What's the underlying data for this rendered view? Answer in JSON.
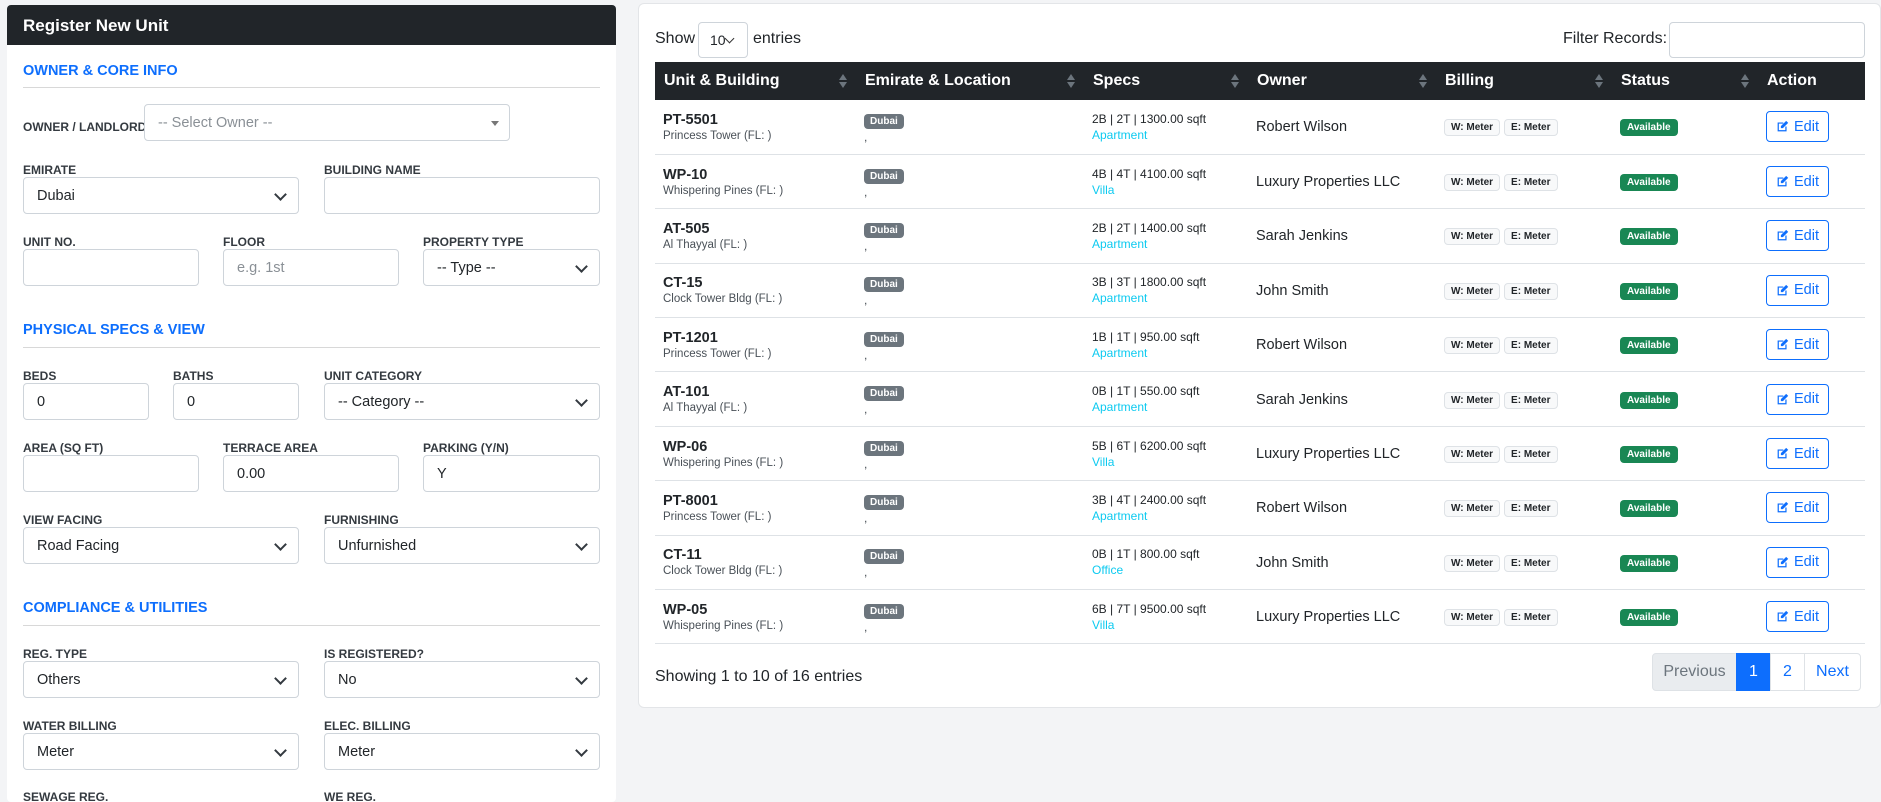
{
  "form": {
    "title": "Register New Unit",
    "sections": {
      "owner_core": "OWNER & CORE INFO",
      "physical": "PHYSICAL SPECS & VIEW",
      "compliance": "COMPLIANCE & UTILITIES"
    },
    "labels": {
      "owner": "OWNER / LANDLORD",
      "emirate": "EMIRATE",
      "building": "BUILDING NAME",
      "unit_no": "UNIT NO.",
      "floor": "FLOOR",
      "ptype": "PROPERTY TYPE",
      "beds": "BEDS",
      "baths": "BATHS",
      "category": "UNIT CATEGORY",
      "area": "AREA (SQ FT)",
      "terrace": "TERRACE AREA",
      "parking": "PARKING (Y/N)",
      "view": "VIEW FACING",
      "furnishing": "FURNISHING",
      "reg_type": "REG. TYPE",
      "is_registered": "IS REGISTERED?",
      "water": "WATER BILLING",
      "elec": "ELEC. BILLING",
      "sewage": "SEWAGE REG.",
      "we_reg": "WE REG."
    },
    "values": {
      "owner": "-- Select Owner --",
      "emirate": "Dubai",
      "building": "",
      "unit_no": "",
      "floor_placeholder": "e.g. 1st",
      "ptype": "-- Type --",
      "beds": "0",
      "baths": "0",
      "category": "-- Category --",
      "area": "",
      "terrace": "0.00",
      "parking": "Y",
      "view": "Road Facing",
      "furnishing": "Unfurnished",
      "reg_type": "Others",
      "is_registered": "No",
      "water": "Meter",
      "elec": "Meter"
    }
  },
  "table": {
    "show_label": "Show",
    "entries_label": "entries",
    "page_length": "10",
    "filter_label": "Filter Records:",
    "headers": [
      "Unit & Building",
      "Emirate & Location",
      "Specs",
      "Owner",
      "Billing",
      "Status",
      "Action"
    ],
    "rows": [
      {
        "code": "PT-5501",
        "bldg": "Princess Tower (FL: )",
        "emirate": "Dubai",
        "loc": ",",
        "specs": "2B | 2T | 1300.00 sqft",
        "ptype": "Apartment",
        "owner": "Robert Wilson",
        "w": "W: Meter",
        "e": "E: Meter",
        "status": "Available",
        "action": "Edit"
      },
      {
        "code": "WP-10",
        "bldg": "Whispering Pines (FL: )",
        "emirate": "Dubai",
        "loc": ",",
        "specs": "4B | 4T | 4100.00 sqft",
        "ptype": "Villa",
        "owner": "Luxury Properties LLC",
        "w": "W: Meter",
        "e": "E: Meter",
        "status": "Available",
        "action": "Edit"
      },
      {
        "code": "AT-505",
        "bldg": "Al Thayyal (FL: )",
        "emirate": "Dubai",
        "loc": ",",
        "specs": "2B | 2T | 1400.00 sqft",
        "ptype": "Apartment",
        "owner": "Sarah Jenkins",
        "w": "W: Meter",
        "e": "E: Meter",
        "status": "Available",
        "action": "Edit"
      },
      {
        "code": "CT-15",
        "bldg": "Clock Tower Bldg (FL: )",
        "emirate": "Dubai",
        "loc": ",",
        "specs": "3B | 3T | 1800.00 sqft",
        "ptype": "Apartment",
        "owner": "John Smith",
        "w": "W: Meter",
        "e": "E: Meter",
        "status": "Available",
        "action": "Edit"
      },
      {
        "code": "PT-1201",
        "bldg": "Princess Tower (FL: )",
        "emirate": "Dubai",
        "loc": ",",
        "specs": "1B | 1T | 950.00 sqft",
        "ptype": "Apartment",
        "owner": "Robert Wilson",
        "w": "W: Meter",
        "e": "E: Meter",
        "status": "Available",
        "action": "Edit"
      },
      {
        "code": "AT-101",
        "bldg": "Al Thayyal (FL: )",
        "emirate": "Dubai",
        "loc": ",",
        "specs": "0B | 1T | 550.00 sqft",
        "ptype": "Apartment",
        "owner": "Sarah Jenkins",
        "w": "W: Meter",
        "e": "E: Meter",
        "status": "Available",
        "action": "Edit"
      },
      {
        "code": "WP-06",
        "bldg": "Whispering Pines (FL: )",
        "emirate": "Dubai",
        "loc": ",",
        "specs": "5B | 6T | 6200.00 sqft",
        "ptype": "Villa",
        "owner": "Luxury Properties LLC",
        "w": "W: Meter",
        "e": "E: Meter",
        "status": "Available",
        "action": "Edit"
      },
      {
        "code": "PT-8001",
        "bldg": "Princess Tower (FL: )",
        "emirate": "Dubai",
        "loc": ",",
        "specs": "3B | 4T | 2400.00 sqft",
        "ptype": "Apartment",
        "owner": "Robert Wilson",
        "w": "W: Meter",
        "e": "E: Meter",
        "status": "Available",
        "action": "Edit"
      },
      {
        "code": "CT-11",
        "bldg": "Clock Tower Bldg (FL: )",
        "emirate": "Dubai",
        "loc": ",",
        "specs": "0B | 1T | 800.00 sqft",
        "ptype": "Office",
        "owner": "John Smith",
        "w": "W: Meter",
        "e": "E: Meter",
        "status": "Available",
        "action": "Edit"
      },
      {
        "code": "WP-05",
        "bldg": "Whispering Pines (FL: )",
        "emirate": "Dubai",
        "loc": ",",
        "specs": "6B | 7T | 9500.00 sqft",
        "ptype": "Villa",
        "owner": "Luxury Properties LLC",
        "w": "W: Meter",
        "e": "E: Meter",
        "status": "Available",
        "action": "Edit"
      }
    ],
    "info": "Showing 1 to 10 of 16 entries",
    "pagination": {
      "prev": "Previous",
      "pages": [
        "1",
        "2"
      ],
      "next": "Next"
    }
  },
  "colors": {
    "primary": "#0d6efd",
    "dark": "#212529",
    "success": "#198754",
    "info": "#0dcaf0",
    "secondary": "#6c757d"
  }
}
